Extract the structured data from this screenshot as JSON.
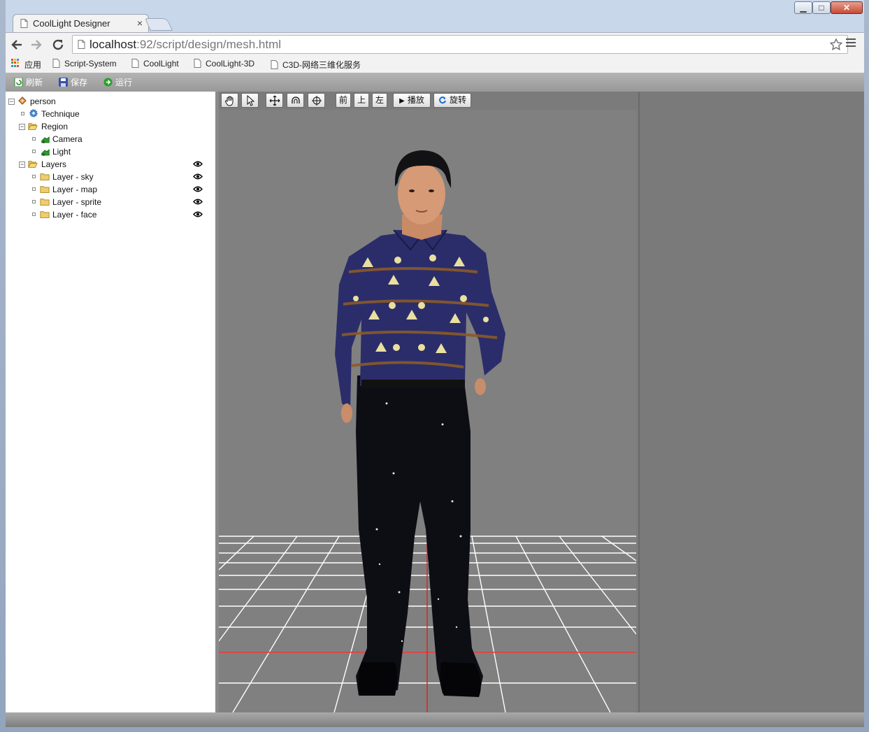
{
  "browser": {
    "tab_title": "CoolLight Designer",
    "tab_close": "×",
    "url_host": "localhost",
    "url_path": ":92/script/design/mesh.html",
    "window_controls": {
      "minimize": "▁",
      "maximize": "□",
      "close": "✕"
    }
  },
  "bookmarks": [
    {
      "label": "应用",
      "icon": "apps-grid-icon"
    },
    {
      "label": "Script-System",
      "icon": "page-icon"
    },
    {
      "label": "CoolLight",
      "icon": "page-icon"
    },
    {
      "label": "CoolLight-3D",
      "icon": "page-icon"
    },
    {
      "label": "C3D-网络三维化服务",
      "icon": "page-icon"
    }
  ],
  "app_toolbar": {
    "refresh": "刷新",
    "save": "保存",
    "run": "运行"
  },
  "tree": {
    "root": "person",
    "items": [
      {
        "label": "Technique",
        "icon": "gear-icon"
      },
      {
        "label": "Region",
        "icon": "folder-open-icon"
      },
      {
        "label": "Camera",
        "icon": "camera-icon"
      },
      {
        "label": "Light",
        "icon": "light-icon"
      },
      {
        "label": "Layers",
        "icon": "folder-open-icon"
      },
      {
        "label": "Layer - sky",
        "icon": "folder-icon"
      },
      {
        "label": "Layer - map",
        "icon": "folder-icon"
      },
      {
        "label": "Layer - sprite",
        "icon": "folder-icon"
      },
      {
        "label": "Layer - face",
        "icon": "folder-icon"
      }
    ],
    "expand_symbol": "−"
  },
  "viewport_toolbar": {
    "front": "前",
    "top": "上",
    "left": "左",
    "play": "播放",
    "play_symbol": "▶",
    "rotate": "旋转"
  },
  "colors": {
    "grid_line": "#ffffff",
    "axis_line": "#e02020",
    "scene_bg": "#808080",
    "shirt": "#2b2d6a",
    "pants": "#0d0d14"
  }
}
